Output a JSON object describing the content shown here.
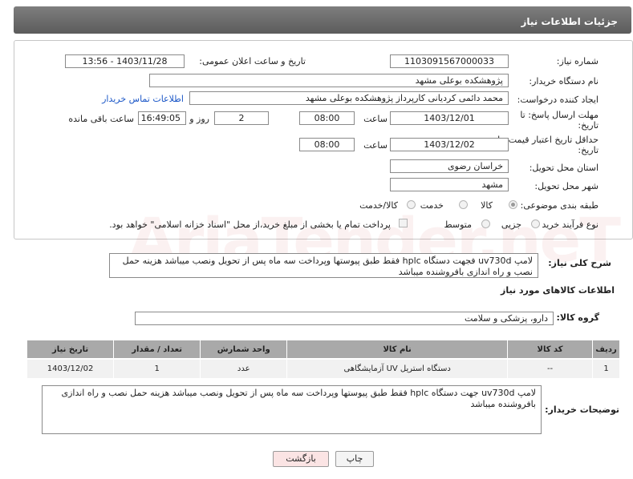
{
  "header": {
    "title": "جزئیات اطلاعات نیاز"
  },
  "form": {
    "need_number_label": "شماره نیاز:",
    "need_number": "1103091567000033",
    "announce_label": "تاریخ و ساعت اعلان عمومی:",
    "announce_value": "1403/11/28 - 13:56",
    "buyer_org_label": "نام دستگاه خریدار:",
    "buyer_org": "پژوهشکده بوعلی  مشهد",
    "creator_label": "ایجاد کننده درخواست:",
    "creator": "محمد دائمی کردیانی کارپرداز پژوهشکده بوعلی  مشهد",
    "contact_link": "اطلاعات تماس خریدار",
    "deadline_label_1": "مهلت ارسال پاسخ: تا",
    "deadline_label_2": "تاریخ:",
    "deadline_date": "1403/12/01",
    "time_label": "ساعت",
    "deadline_time": "08:00",
    "days_value": "2",
    "days_label": "روز و",
    "remaining_time": "16:49:05",
    "remaining_label": "ساعت باقی مانده",
    "validity_label_1": "حداقل تاریخ اعتبار قیمت: تا",
    "validity_label_2": "تاریخ:",
    "validity_date": "1403/12/02",
    "validity_time": "08:00",
    "province_label": "استان محل تحویل:",
    "province": "خراسان رضوی",
    "city_label": "شهر محل تحویل:",
    "city": "مشهد",
    "category_label": "طبقه بندی موضوعی:",
    "category_options": [
      "کالا",
      "خدمت",
      "کالا/خدمت"
    ],
    "process_label": "نوع فرآیند خرید :",
    "process_options": [
      "جزیی",
      "متوسط"
    ],
    "payment_note": "پرداخت تمام یا بخشی از مبلغ خرید،از محل \"اسناد خزانه اسلامی\" خواهد بود."
  },
  "overview": {
    "label": "شرح کلی نیاز:",
    "text": "لامپ uv730d فجهت دستگاه hplc فقط طبق پیوستها وپرداخت سه ماه پس از تحویل ونصب میباشد هزینه حمل نصب و راه اندازی بافروشنده میباشد"
  },
  "goods_section": {
    "title": "اطلاعات کالاهای مورد نیاز",
    "group_label": "گروه کالا:",
    "group_value": "دارو، پزشکی و سلامت"
  },
  "table": {
    "headers": [
      "ردیف",
      "کد کالا",
      "نام کالا",
      "واحد شمارش",
      "تعداد / مقدار",
      "تاریخ نیاز"
    ],
    "rows": [
      [
        "1",
        "--",
        "دستگاه استریل UV آزمایشگاهی",
        "عدد",
        "1",
        "1403/12/02"
      ]
    ]
  },
  "buyer_notes": {
    "label": "توضیحات خریدار:",
    "text": "لامپ uv730d جهت دستگاه hplc فقط طبق پیوستها وپرداخت سه ماه پس از تحویل ونصب میباشد هزینه حمل نصب و راه اندازی بافروشنده میباشد"
  },
  "buttons": {
    "print": "چاپ",
    "back": "بازگشت"
  },
  "watermark": "AriaTender.neT"
}
